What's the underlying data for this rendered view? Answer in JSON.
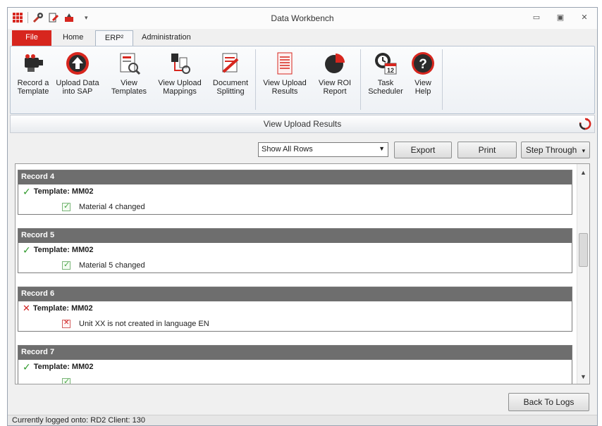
{
  "window": {
    "title": "Data Workbench"
  },
  "tabs": {
    "file": "File",
    "home": "Home",
    "erp": "ERP²",
    "admin": "Administration"
  },
  "ribbon": {
    "buttons": [
      {
        "line1": "Record a",
        "line2": "Template",
        "icon": "record-template-icon"
      },
      {
        "line1": "Upload Data",
        "line2": "into SAP",
        "icon": "upload-icon"
      },
      {
        "line1": "View",
        "line2": "Templates",
        "icon": "view-templates-icon"
      },
      {
        "line1": "View Upload",
        "line2": "Mappings",
        "icon": "mappings-icon"
      },
      {
        "line1": "Document",
        "line2": "Splitting",
        "icon": "document-splitting-icon"
      },
      {
        "line1": "View Upload",
        "line2": "Results",
        "icon": "upload-results-icon"
      },
      {
        "line1": "View ROI",
        "line2": "Report",
        "icon": "pie-chart-icon"
      },
      {
        "line1": "Task",
        "line2": "Scheduler",
        "icon": "calendar-icon"
      },
      {
        "line1": "View",
        "line2": "Help",
        "icon": "help-icon"
      }
    ]
  },
  "header": {
    "title": "View Upload Results"
  },
  "toolbar": {
    "filter_value": "Show All Rows",
    "export": "Export",
    "print": "Print",
    "step": "Step Through"
  },
  "records": [
    {
      "title": "Record 4",
      "template": "Template: MM02",
      "status": "ok",
      "message": "Material 4 changed"
    },
    {
      "title": "Record 5",
      "template": "Template: MM02",
      "status": "ok",
      "message": "Material 5 changed"
    },
    {
      "title": "Record 6",
      "template": "Template: MM02",
      "status": "error",
      "message": "Unit XX is not created in language EN"
    },
    {
      "title": "Record 7",
      "template": "Template: MM02",
      "status": "ok",
      "message": ""
    }
  ],
  "back_button": "Back To Logs",
  "status_bar": "Currently logged onto: RD2 Client: 130",
  "colors": {
    "file_tab": "#d7261e",
    "record_header": "#6e6e6e",
    "ok": "#2f9a2c",
    "error": "#d02020"
  }
}
